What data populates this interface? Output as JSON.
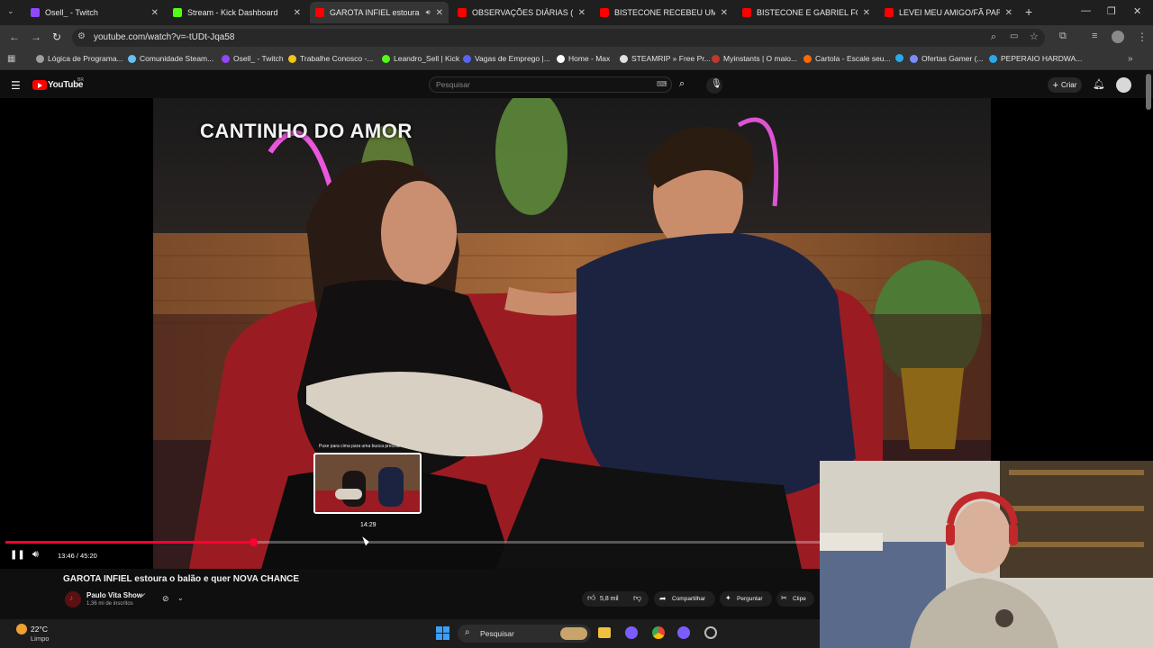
{
  "browser": {
    "tabs": [
      {
        "title": "Osell_ - Twitch",
        "icon": "twitch-icon",
        "color": "#9146ff"
      },
      {
        "title": "Stream - Kick Dashboard",
        "icon": "kick-icon",
        "color": "#53fc18"
      },
      {
        "title": "GAROTA INFIEL estoura o b",
        "icon": "youtube-icon",
        "color": "#ff0000",
        "active": true
      },
      {
        "title": "OBSERVAÇÕES DIÁRIAS (EP. 3",
        "icon": "youtube-icon",
        "color": "#ff0000"
      },
      {
        "title": "BISTECONE RECEBEU UM PRES",
        "icon": "youtube-icon",
        "color": "#ff0000"
      },
      {
        "title": "BISTECONE E GABRIEL FORAM",
        "icon": "youtube-icon",
        "color": "#ff0000"
      },
      {
        "title": "LEVEI MEU AMIGO/FÃ PARA U",
        "icon": "youtube-icon",
        "color": "#ff0000"
      }
    ],
    "url": "youtube.com/watch?v=-tUDt-Jqa58",
    "bookmarks": [
      {
        "label": "Lógica de Programa...",
        "color": "#9e9e9e"
      },
      {
        "label": "Comunidade Steam...",
        "color": "#66c0f4"
      },
      {
        "label": "Osell_ - Twitch",
        "color": "#9146ff"
      },
      {
        "label": "Trabalhe Conosco -...",
        "color": "#f0c419"
      },
      {
        "label": "Leandro_Sell | Kick",
        "color": "#53fc18"
      },
      {
        "label": "Vagas de Emprego |...",
        "color": "#5865f2"
      },
      {
        "label": "Home - Max",
        "color": "#ffffff"
      },
      {
        "label": "STEAMRIP » Free Pr...",
        "color": "#e0e0e0"
      },
      {
        "label": "Myinstants | O maio...",
        "color": "#c0392b"
      },
      {
        "label": "Cartola - Escale seu...",
        "color": "#ff6a00"
      },
      {
        "label": "",
        "color": "#29a9eb"
      },
      {
        "label": "Ofertas Gamer (...",
        "color": "#7b8cff"
      },
      {
        "label": "PEPERAIO HARDWA...",
        "color": "#29a9eb"
      }
    ]
  },
  "youtube": {
    "logo": "YouTube",
    "region": "BR",
    "search_placeholder": "Pesquisar",
    "create_label": "Criar"
  },
  "video": {
    "overlay_text": "CANTINHO DO AMOR",
    "preview_hint": "Puxe para cima para uma busca precisa",
    "preview_time": "14:29",
    "time_display": "13:46 / 45:20",
    "progress_fraction": 0.304,
    "title": "GAROTA INFIEL estoura o balão e quer NOVA CHANCE",
    "channel_name": "Paulo Vita Show",
    "subscribers": "1,36 mi de inscritos",
    "likes": "5,8 mil",
    "share_label": "Compartilhar",
    "ask_label": "Perguntar",
    "clip_label": "Clipe"
  },
  "taskbar": {
    "weather_temp": "22°C",
    "weather_desc": "Limpo",
    "search_label": "Pesquisar"
  }
}
